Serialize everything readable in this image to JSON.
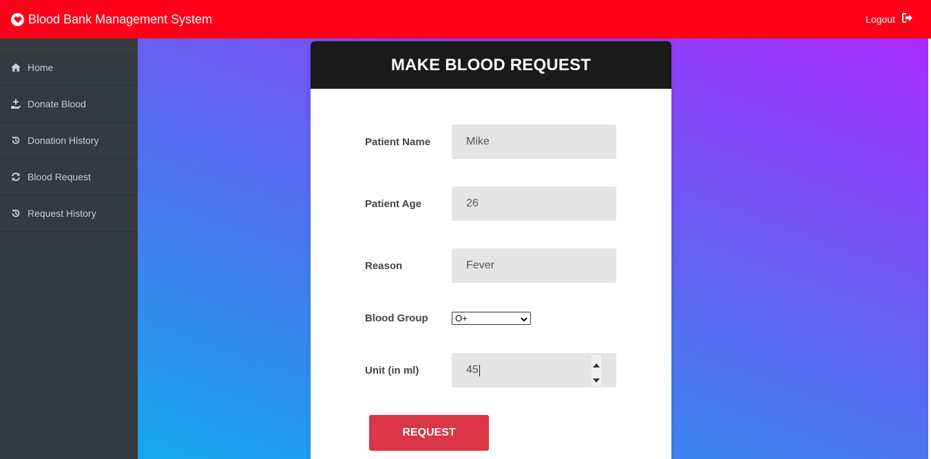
{
  "header": {
    "title": "Blood Bank Management System",
    "logout_label": "Logout",
    "brand_color": "#ff0018"
  },
  "sidebar": {
    "items": [
      {
        "label": "Home",
        "icon": "home-icon"
      },
      {
        "label": "Donate Blood",
        "icon": "hand-holding-icon"
      },
      {
        "label": "Donation History",
        "icon": "history-icon"
      },
      {
        "label": "Blood Request",
        "icon": "refresh-icon"
      },
      {
        "label": "Request History",
        "icon": "history-icon"
      }
    ]
  },
  "form": {
    "title": "MAKE BLOOD REQUEST",
    "patient_name_label": "Patient Name",
    "patient_name_value": "Mike",
    "patient_age_label": "Patient Age",
    "patient_age_value": "26",
    "reason_label": "Reason",
    "reason_value": "Fever",
    "blood_group_label": "Blood Group",
    "blood_group_value": "O+",
    "unit_label": "Unit (in ml)",
    "unit_value": "45",
    "submit_label": "REQUEST",
    "submit_color": "#dc3545"
  }
}
